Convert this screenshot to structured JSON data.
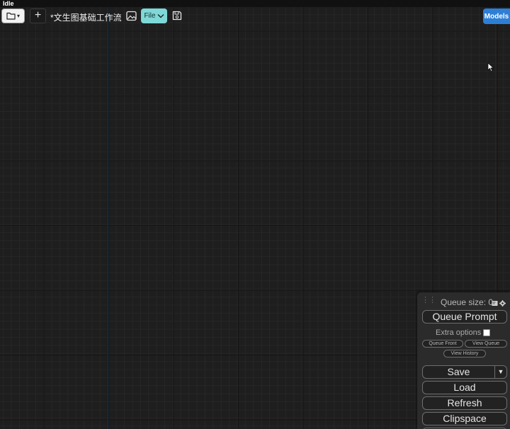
{
  "status": {
    "text": "Idle"
  },
  "toolbar": {
    "workflow_button": {
      "icon": "folder-icon",
      "chevron": "▾"
    },
    "add_label": "+",
    "workflow_name": "*文生图基础工作流",
    "file_label": "File",
    "models_label": "Models"
  },
  "queue_panel": {
    "queue_size_label": "Queue size: 0",
    "queue_prompt_label": "Queue Prompt",
    "extra_options_label": "Extra options",
    "extra_options_checked": false,
    "queue_front_label": "Queue Front",
    "view_queue_label": "View Queue",
    "view_history_label": "View History",
    "save_label": "Save",
    "save_dropdown": "▼",
    "load_label": "Load",
    "refresh_label": "Refresh",
    "clipspace_label": "Clipspace"
  },
  "colors": {
    "canvas_bg": "#1e1e1e",
    "file_button": "#7fd8d8",
    "models_button": "#2d7fd6",
    "panel_bg": "#2b2b2b"
  }
}
